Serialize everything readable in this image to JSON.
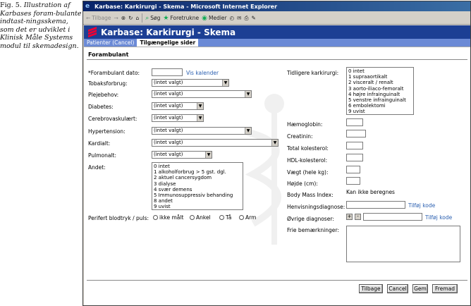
{
  "caption": {
    "fig": "Fig. 5.",
    "text": "Illustration af Karbases foram-bulante indtast-ningsskema, som det er udviklet i Klinisk Måle Systems modul til skemadesign."
  },
  "window": {
    "title": "Karbase: Karkirurgi - Skema - Microsoft Internet Explorer",
    "toolbar": {
      "back": "Tilbage",
      "forward": "→",
      "search": "Søg",
      "favorites": "Foretrukne",
      "media": "Medier"
    }
  },
  "app": {
    "header_title": "Karbase: Karkirurgi - Skema",
    "tabs": [
      {
        "label": "Patienter (Cancel)"
      },
      {
        "label": "Tilgængelige sider"
      }
    ],
    "section_title": "Forambulant"
  },
  "form_left": {
    "date_label": "*Forambulant dato:",
    "calendar_link": "Vis kalender",
    "fields": [
      {
        "label": "Tobaksforbrug:",
        "value": "(intet valgt)"
      },
      {
        "label": "Plejebehov:",
        "value": "(intet valgt)"
      },
      {
        "label": "Diabetes:",
        "value": "(intet valgt)"
      },
      {
        "label": "Cerebrovaskulært:",
        "value": "(intet valgt)"
      },
      {
        "label": "Hypertension:",
        "value": "(intet valgt)"
      },
      {
        "label": "Kardialt:",
        "value": "(intet valgt)"
      },
      {
        "label": "Pulmonalt:",
        "value": "(intet valgt)"
      }
    ],
    "andet_label": "Andet:",
    "andet_options": [
      "0 intet",
      "1 alkoholforbrug > 5 gst. dgl.",
      "2 aktuel cancersygdom",
      "3 dialyse",
      "4 svær demens",
      "5 Immunosuppressiv behanding",
      "8 andet",
      "9 uvist"
    ],
    "perifert_label": "Perifert blodtryk / puls:",
    "perifert_options": [
      "ikke målt",
      "Ankel",
      "Tå",
      "Arm"
    ]
  },
  "form_right": {
    "tidligere_label": "Tidligere karkirurgi:",
    "tidligere_options": [
      "0 intet",
      "1 supraaortikalt",
      "2 visceralt / renalt",
      "3 aorto-iliaco-femoralt",
      "4 højre infrainguinalt",
      "5 venstre infrainguinalt",
      "6 embolektomi",
      "9 uvist"
    ],
    "lab_fields": [
      {
        "label": "Hæmoglobin:"
      },
      {
        "label": "Creatinin:"
      },
      {
        "label": "Total kolesterol:"
      },
      {
        "label": "HDL-kolesterol:"
      },
      {
        "label": "Vægt (hele kg):"
      },
      {
        "label": "Højde (cm):"
      }
    ],
    "bmi_label": "Body Mass Index:",
    "bmi_value": "Kan ikke beregnes",
    "henvisning_label": "Henvisningsdiagnose:",
    "henvisning_link": "Tilføj kode",
    "ovrige_label": "Øvrige diagnoser:",
    "ovrige_plus": "+",
    "ovrige_minus": "-",
    "ovrige_link": "Tilføj kode",
    "fri_label": "Frie bemærkninger:"
  },
  "buttons": {
    "back": "Tilbage",
    "cancel": "Cancel",
    "save": "Gem",
    "forward": "Fremad"
  }
}
